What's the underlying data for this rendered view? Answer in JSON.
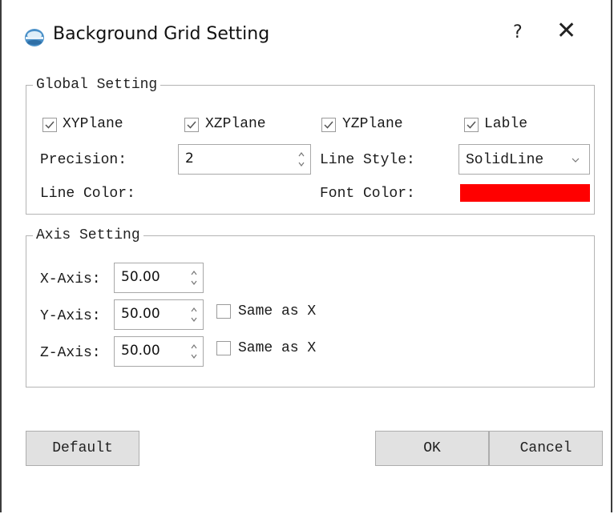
{
  "window": {
    "title": "Background Grid Setting",
    "help": "?",
    "close": "✕"
  },
  "global": {
    "title": "Global Setting",
    "checks": [
      {
        "label": "XYPlane",
        "checked": true
      },
      {
        "label": "XZPlane",
        "checked": true
      },
      {
        "label": "YZPlane",
        "checked": true
      },
      {
        "label": "Lable",
        "checked": true
      }
    ],
    "precision_label": "Precision:",
    "precision_value": "2",
    "line_style_label": "Line Style:",
    "line_style_value": "SolidLine",
    "line_color_label": "Line Color:",
    "font_color_label": "Font Color:",
    "font_color": "#ff0000"
  },
  "axis": {
    "title": "Axis Setting",
    "x_label": "X-Axis:",
    "x_value": "50.00",
    "y_label": "Y-Axis:",
    "y_value": "50.00",
    "y_same_label": "Same as X",
    "z_label": "Z-Axis:",
    "z_value": "50.00",
    "z_same_label": "Same as X"
  },
  "buttons": {
    "default": "Default",
    "ok": "OK",
    "cancel": "Cancel"
  }
}
